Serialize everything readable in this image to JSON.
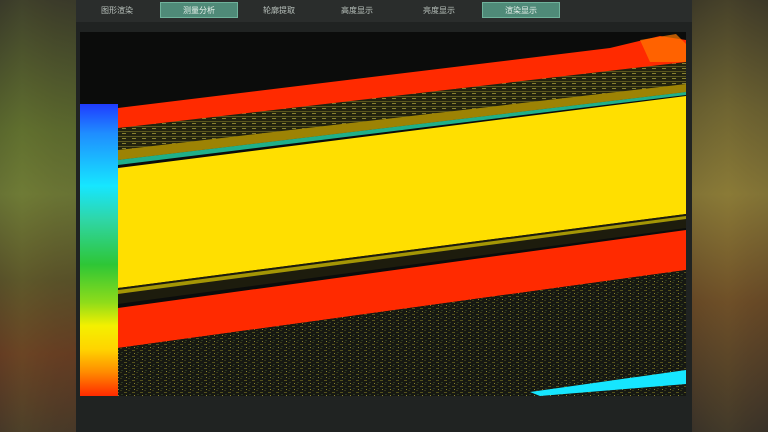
{
  "toolbar": {
    "tabs": [
      {
        "label": "图形渲染",
        "active": false
      },
      {
        "label": "测量分析",
        "active": true
      },
      {
        "label": "轮廓提取",
        "active": false
      },
      {
        "label": "高度显示",
        "active": false
      },
      {
        "label": "亮度显示",
        "active": false
      },
      {
        "label": "渲染显示",
        "active": true
      }
    ]
  },
  "colors": {
    "accent": "#4f8a78",
    "yellow": "#ffdf00",
    "red": "#ff2a00",
    "cyan": "#16e6ff"
  }
}
